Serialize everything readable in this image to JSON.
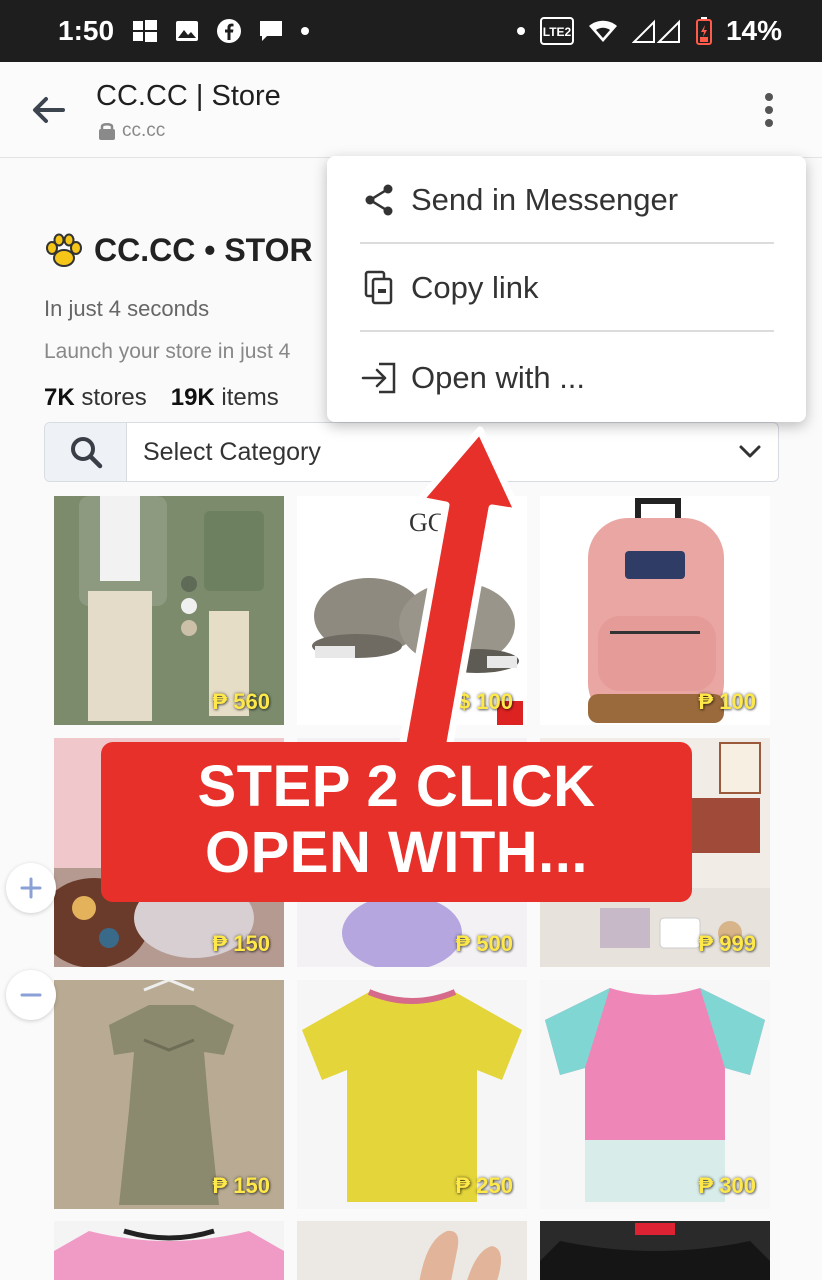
{
  "status_bar": {
    "time": "1:50",
    "battery": "14%",
    "network": "LTE2",
    "left_icons": [
      "windows-icon",
      "gallery-icon",
      "facebook-icon",
      "chat-icon"
    ],
    "right_icons": [
      "wifi-icon",
      "signal-icon",
      "battery-icon"
    ]
  },
  "browser": {
    "title": "CC.CC | Store",
    "url": "cc.cc"
  },
  "store": {
    "title": "CC.CC • STOR",
    "subtitle": "In just 4 seconds",
    "description": "Launch your store in just 4",
    "stats": [
      {
        "value": "7K",
        "label": "stores"
      },
      {
        "value": "19K",
        "label": "items"
      }
    ]
  },
  "search": {
    "category_label": "Select Category"
  },
  "menu": {
    "items": [
      {
        "label": "Send in Messenger",
        "icon": "share-icon"
      },
      {
        "label": "Copy link",
        "icon": "copy-icon"
      },
      {
        "label": "Open with ...",
        "icon": "open-with-icon"
      }
    ]
  },
  "products": [
    {
      "price": "₱ 560",
      "desc": "green jacket outfit"
    },
    {
      "price": "$ 100",
      "desc": "snakeskin caps"
    },
    {
      "price": "₱ 100",
      "desc": "pink backpack"
    },
    {
      "price": "₱ 150",
      "desc": "clothing pile"
    },
    {
      "price": "₱ 500",
      "desc": "purple bag"
    },
    {
      "price": "₱ 999",
      "desc": "desk items"
    },
    {
      "price": "₱ 150",
      "desc": "beige dress"
    },
    {
      "price": "₱ 250",
      "desc": "yellow shirt"
    },
    {
      "price": "₱ 300",
      "desc": "pink tee"
    },
    {
      "price": "",
      "desc": "pink shirt"
    },
    {
      "price": "",
      "desc": "hand"
    },
    {
      "price": "",
      "desc": "black shirt"
    }
  ],
  "annotation": {
    "line1": "STEP 2 CLICK",
    "line2": "OPEN WITH..."
  },
  "colors": {
    "accent_red": "#e8302a",
    "price_yellow": "#ffe94a",
    "status_bar": "#1e1e1e"
  }
}
